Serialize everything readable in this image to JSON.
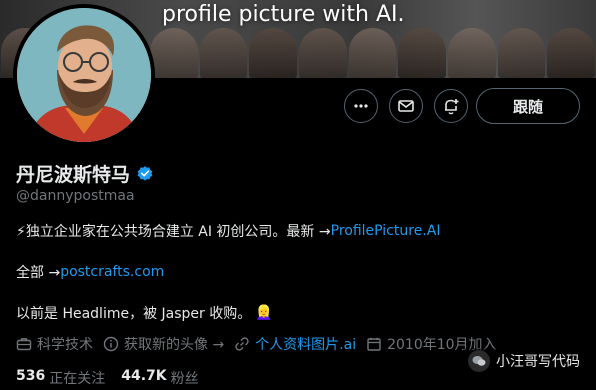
{
  "banner": {
    "text": "profile picture with AI."
  },
  "profile": {
    "name": "丹尼波斯特马",
    "handle": "@dannypostmaa",
    "bio_line1_prefix": "⚡独立企业家在公共场合建立 AI 初创公司。最新 → ",
    "bio_line1_link": "ProfilePicture.AI",
    "bio_line2_prefix": "全部 → ",
    "bio_line2_link": "postcrafts.com",
    "bio_line3": "以前是 Headlime，被 Jasper 收购。",
    "bio_line3_emoji": "👱‍♀️"
  },
  "meta": {
    "category": "科学技术",
    "cta": "获取新的头像 →",
    "website": "个人资料图片.ai",
    "joined": "2010年10月加入"
  },
  "stats": {
    "following_count": "536",
    "following_label": "正在关注",
    "followers_count": "44.7K",
    "followers_label": "粉丝"
  },
  "actions": {
    "follow_label": "跟随",
    "icons": [
      "more-icon",
      "mail-icon",
      "notify-plus-icon"
    ]
  },
  "watermark": {
    "text": "小汪哥写代码"
  },
  "colors": {
    "link": "#1d9bf0",
    "muted": "#71767b",
    "verified": "#1d9bf0",
    "background": "#000000"
  }
}
